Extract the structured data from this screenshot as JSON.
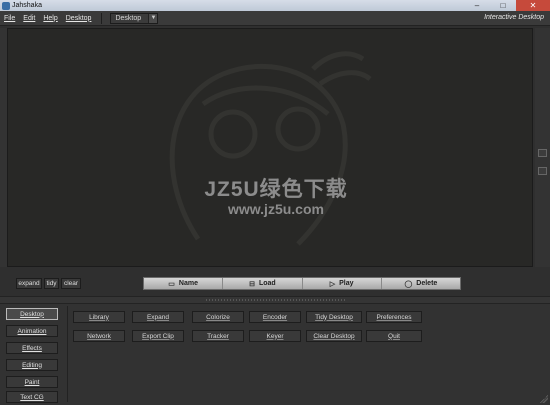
{
  "window": {
    "title": "Jahshaka",
    "buttons": [
      "–",
      "□",
      "✕"
    ]
  },
  "menubar": {
    "items": [
      "File",
      "Edit",
      "Help",
      "Desktop"
    ],
    "desktop_select": "Desktop",
    "mode_label": "Interactive Desktop"
  },
  "watermark": {
    "line1": "JZ5U绿色下载",
    "line2": "www.jz5u.com"
  },
  "view_controls": [
    "expand",
    "tidy",
    "clear"
  ],
  "transport": [
    {
      "label": "Name",
      "icon": "name-icon"
    },
    {
      "label": "Load",
      "icon": "load-icon"
    },
    {
      "label": "Play",
      "icon": "play-icon"
    },
    {
      "label": "Delete",
      "icon": "delete-icon"
    }
  ],
  "modules": [
    "Desktop",
    "Animation",
    "Effects",
    "Editing",
    "Paint",
    "Text CG"
  ],
  "active_module": "Desktop",
  "desktop_buttons": {
    "row1": [
      "Library",
      "Expand",
      "Colorize",
      "Encoder",
      "Tidy Desktop",
      "Preferences"
    ],
    "row2": [
      "Network",
      "Export Clip",
      "Tracker",
      "Keyer",
      "Clear Desktop",
      "Quit"
    ]
  },
  "colors": {
    "background": "#2f2f2f",
    "viewport": "#282826",
    "transport": "#b8b8b8",
    "close": "#c64a3b"
  }
}
